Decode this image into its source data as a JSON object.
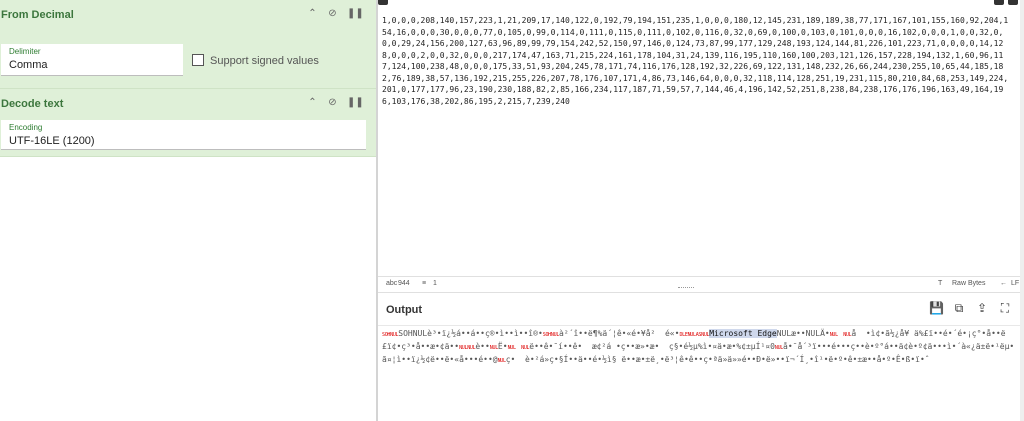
{
  "recipe": {
    "from_decimal": {
      "title": "From Decimal",
      "delimiter_label": "Delimiter",
      "delimiter_value": "Comma",
      "signed_label": "Support signed values"
    },
    "decode_text": {
      "title": "Decode text",
      "encoding_label": "Encoding",
      "encoding_value": "UTF-16LE (1200)"
    }
  },
  "input": {
    "text": "1,0,0,0,208,140,157,223,1,21,209,17,140,122,0,192,79,194,151,235,1,0,0,0,180,12,145,231,189,189,38,77,171,167,101,155,160,92,204,154,16,0,0,0,30,0,0,0,77,0,105,0,99,0,114,0,111,0,115,0,111,0,102,0,116,0,32,0,69,0,100,0,103,0,101,0,0,0,16,102,0,0,0,1,0,0,32,0,0,0,29,24,156,200,127,63,96,89,99,79,154,242,52,150,97,146,0,124,73,87,99,177,129,248,193,124,144,81,226,101,223,71,0,0,0,0,14,128,0,0,0,2,0,0,32,0,0,0,217,174,47,163,71,215,224,161,178,104,31,24,139,116,195,110,160,100,203,121,126,157,228,194,132,1,60,96,117,124,100,238,48,0,0,0,175,33,51,93,204,245,78,171,74,116,176,128,192,32,226,69,122,131,148,232,26,66,244,230,255,10,65,44,185,182,76,189,38,57,136,192,215,255,226,207,78,176,107,171,4,86,73,146,64,0,0,0,32,118,114,128,251,19,231,115,80,210,84,68,253,149,224,201,0,177,177,96,23,190,230,188,82,2,85,166,234,117,187,71,59,57,7,144,46,4,196,142,52,251,8,238,84,238,176,176,196,163,49,164,196,103,176,38,202,86,195,2,215,7,239,240"
  },
  "status": {
    "chars_icon": "abc",
    "chars": "944",
    "lines_icon": "lines-icon",
    "lines": "1",
    "raw_bytes_label": "Raw Bytes",
    "eol_label": "LF"
  },
  "output": {
    "title": "Output",
    "seg1": "SOHNULè³•ï¿½á••á••ç®•ì••ì••î®•",
    "seg2": "SOHNUL",
    "seg3": "à²´î••ë¶%ä´¦ê•«é•¥å²  é«•",
    "seg4": "DLENULASNUL",
    "seg5": "Microsoft Edge",
    "seg6": "NULæ••NULÄ•",
    "seg7": "NUL  NUL",
    "seg8": "å  •ì¢•ã½¿å¥ ä%£ï••é•´é•¡ç°•å••ë£ï¢•ç³•å••æ•¢ä••",
    "seg9": "NULNUL",
    "seg10": "è••",
    "seg11": "NUL",
    "seg12": "Ë•",
    "seg13": "NUL  NUL",
    "seg14": "ë••ê•¯í••ê•  æ¢²á •ç••æ»•æ•  ç§•é½µ%ì•¤ä•æ•%¢±µÍ¹¤0",
    "seg15": "NUL",
    "seg16": "å•¯å´³ï•••é•••ç••è•º°á••ä¢è•º¢ä•••ì•´à«¿ä±ë•¹ëµ•ã¤¦ì••ï¿½¢ë••ë•«å•••é••@",
    "seg17": "NUL",
    "seg18": "ç•  è•²á»ç•§Í••ä••é•½ì§ ë••æ•±ë¸•ë³¦ê•ê••ç•ªä»ä»»é••Ð•ë»••ï¬´Í¸•î¹•ë•º•ê•±æ••å•º•Ê•ß•ï•ˆ"
  },
  "icons": {
    "collapse": "chevron-up-icon",
    "disable": "disable-icon",
    "pause": "pause-icon",
    "save": "save-icon",
    "copy": "copy-icon",
    "replace": "replace-input-icon",
    "maximise": "maximise-icon"
  },
  "colors": {
    "recipe_bg": "#dff0d8",
    "recipe_title": "#3c763d",
    "control_char": "#dd0000",
    "highlight": "#cfd8ec"
  }
}
